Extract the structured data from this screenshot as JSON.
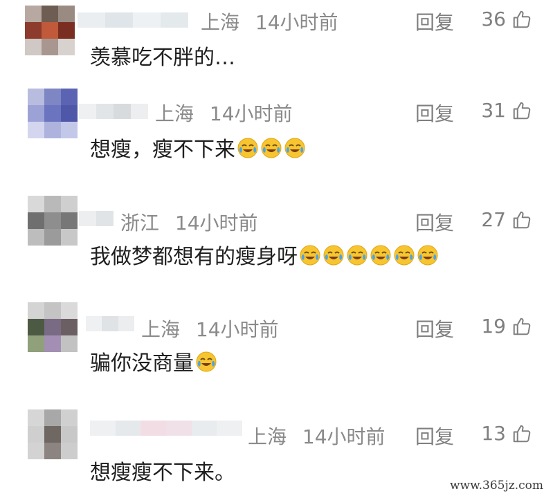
{
  "comments": [
    {
      "location": "上海",
      "time": "14小时前",
      "reply_label": "回复",
      "likes": "36",
      "text": "羡慕吃不胖的…",
      "emoji_count": 0
    },
    {
      "location": "上海",
      "time": "14小时前",
      "reply_label": "回复",
      "likes": "31",
      "text": "想瘦，瘦不下来",
      "emoji_count": 3
    },
    {
      "location": "浙江",
      "time": "14小时前",
      "reply_label": "回复",
      "likes": "27",
      "text": "我做梦都想有的瘦身呀",
      "emoji_count": 6
    },
    {
      "location": "上海",
      "time": "14小时前",
      "reply_label": "回复",
      "likes": "19",
      "text": "骗你没商量",
      "emoji_count": 1
    },
    {
      "location": "上海",
      "time": "14小时前",
      "reply_label": "回复",
      "likes": "13",
      "text": "想瘦瘦不下来。",
      "emoji_count": 0
    }
  ],
  "icons": {
    "like": "thumbs-up-icon",
    "emoji": "laughing-crying-emoji"
  },
  "watermark": "www.365jz.com"
}
